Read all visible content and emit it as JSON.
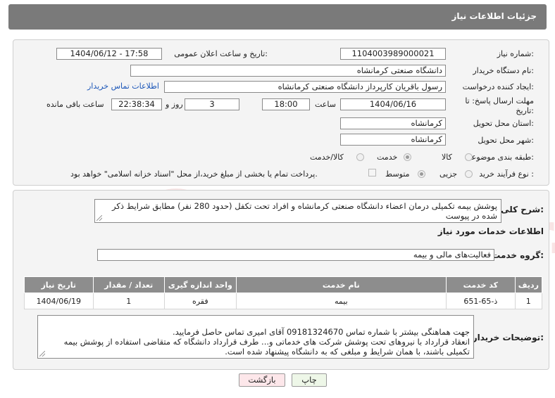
{
  "header": {
    "title": "جزئیات اطلاعات نیاز"
  },
  "form": {
    "need_number_label": "شماره نیاز:",
    "need_number": "1104003989000021",
    "announce_label": "تاریخ و ساعت اعلان عمومی:",
    "announce_value": "1404/06/12 - 17:58",
    "buyer_org_label": "نام دستگاه خریدار:",
    "buyer_org": "دانشگاه صنعتی کرمانشاه",
    "requester_label": "ایجاد کننده درخواست:",
    "requester": "رسول باقریان کارپرداز دانشگاه صنعتی کرمانشاه",
    "contact_link": "اطلاعات تماس خریدار",
    "deadline_label_line1": "مهلت ارسال پاسخ: تا",
    "deadline_label_line2": "تاریخ:",
    "deadline_date": "1404/06/16",
    "time_label": "ساعت",
    "deadline_time": "18:00",
    "days_value": "3",
    "days_label": "روز و",
    "remaining_time": "22:38:34",
    "remaining_label": "ساعت باقی مانده",
    "province_label": "استان محل تحویل:",
    "province": "کرمانشاه",
    "city_label": "شهر محل تحویل:",
    "city": "کرمانشاه",
    "category_label": "طبقه بندی موضوعی:",
    "category_options": [
      "کالا",
      "خدمت",
      "کالا/خدمت"
    ],
    "category_selected": "خدمت",
    "process_label": "نوع فرآیند خرید :",
    "process_options": [
      "جزیی",
      "متوسط"
    ],
    "process_selected": "متوسط",
    "treasury_note": "پرداخت تمام یا بخشی از مبلغ خرید،از محل \"اسناد خزانه اسلامی\" خواهد بود."
  },
  "summary": {
    "label": "شرح کلی نیاز:",
    "text": "پوشش بیمه تکمیلی درمان اعضاء دانشگاه صنعتی کرمانشاه و افراد تحت تکفل (حدود 280 نفر) مطابق شرایط ذکر شده در پیوست"
  },
  "services": {
    "section_title": "اطلاعات خدمات مورد نیاز",
    "group_label": "گروه خدمت:",
    "group_value": "فعالیت‌های مالی و بیمه",
    "columns": [
      "ردیف",
      "کد خدمت",
      "نام خدمت",
      "واحد اندازه گیری",
      "تعداد / مقدار",
      "تاریخ نیاز"
    ],
    "rows": [
      [
        "1",
        "ذ-65-651",
        "بیمه",
        "فقره",
        "1",
        "1404/06/19"
      ]
    ]
  },
  "buyer_notes": {
    "label": "توضیحات خریدار:",
    "text": "جهت هماهنگی بیشتر با شماره تماس 09181324670 آقای امیری تماس حاصل فرمایید.\nانعقاد قرارداد با نیروهای تحت پوشش شرکت های خدماتی و... طرف قرارداد دانشگاه که متقاضی استفاده از پوشش بیمه تکمیلی باشند، با همان شرایط و مبلغی که به دانشگاه پیشنهاد شده است."
  },
  "buttons": {
    "print": "چاپ",
    "back": "بازگشت"
  },
  "watermark": {
    "text": "AriaTender.net"
  },
  "colors": {
    "header_bg": "#7a7a7a",
    "link": "#1b56b8",
    "back_btn_bg": "#fde7ea",
    "print_btn_bg": "#eef7e8"
  }
}
